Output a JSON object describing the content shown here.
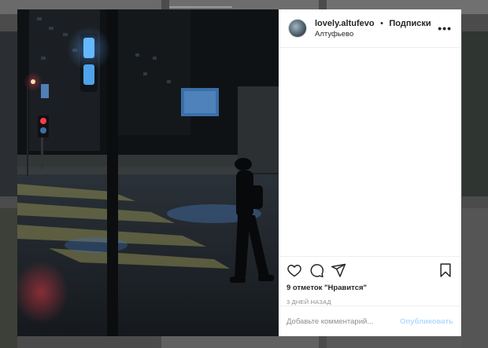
{
  "post": {
    "username": "lovely.altufevo",
    "separator": "•",
    "follow_label": "Подписки",
    "location": "Алтуфьево",
    "more_label": "•••",
    "likes": "9 отметок \"Нравится\"",
    "time": "3 ДНЕЙ НАЗАД"
  },
  "comment": {
    "placeholder": "Добавьте комментарий...",
    "publish_label": "Опубликовать"
  },
  "icons": {
    "like": "heart-icon",
    "comment": "comment-icon",
    "share": "share-icon",
    "save": "bookmark-icon"
  }
}
